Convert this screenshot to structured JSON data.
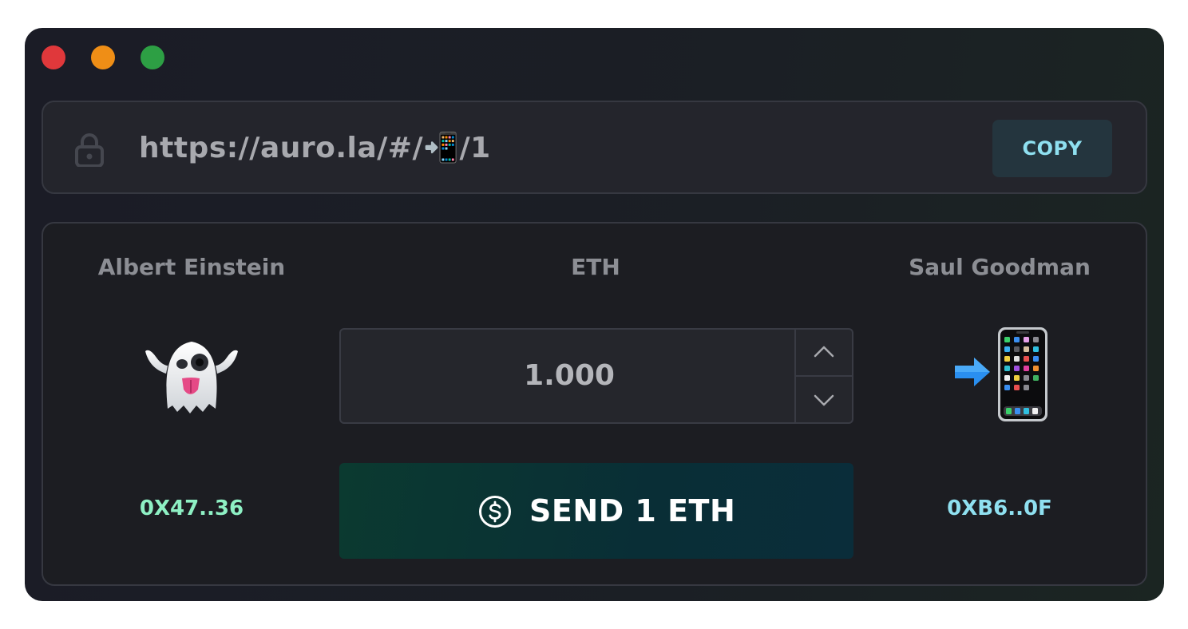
{
  "window": {
    "traffic_lights": [
      "close",
      "minimize",
      "zoom"
    ]
  },
  "urlbar": {
    "url": "https://auro.la/#/📲/1",
    "copy_label": "COPY"
  },
  "transfer": {
    "sender": {
      "name": "Albert Einstein",
      "avatar": "👻",
      "address": "0X47..36"
    },
    "currency": "ETH",
    "amount": "1.000",
    "recipient": {
      "name": "Saul Goodman",
      "avatar": "📲",
      "address": "0XB6..0F"
    },
    "send_label": "SEND 1 ETH"
  },
  "colors": {
    "sender_address": "#8ef0c4",
    "recipient_address": "#8fe0f0",
    "copy_text": "#8fe0f0"
  }
}
